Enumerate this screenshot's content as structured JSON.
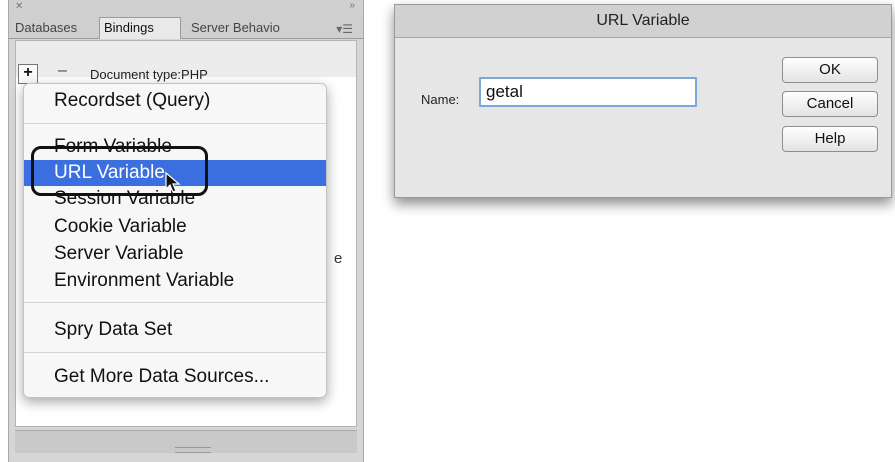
{
  "panel": {
    "tabs": [
      "Databases",
      "Bindings",
      "Server Behavio"
    ],
    "doctype": "Document type:PHP",
    "stray_text": "e"
  },
  "menu": {
    "items": [
      "Recordset (Query)",
      "Form Variable",
      "URL Variable",
      "Session Variable",
      "Cookie Variable",
      "Server Variable",
      "Environment Variable",
      "Spry Data Set",
      "Get More Data Sources..."
    ],
    "highlighted": "URL Variable"
  },
  "dialog": {
    "title": "URL Variable",
    "name_label": "Name:",
    "name_value": "getal",
    "buttons": {
      "ok": "OK",
      "cancel": "Cancel",
      "help": "Help"
    }
  },
  "colors": {
    "highlight": "#3b6fe0",
    "input_focus": "#7ea7dd"
  },
  "icons": [
    "close-icon",
    "collapse-icon",
    "panel-menu-icon",
    "plus-icon",
    "minus-icon",
    "pointer-cursor-icon"
  ]
}
